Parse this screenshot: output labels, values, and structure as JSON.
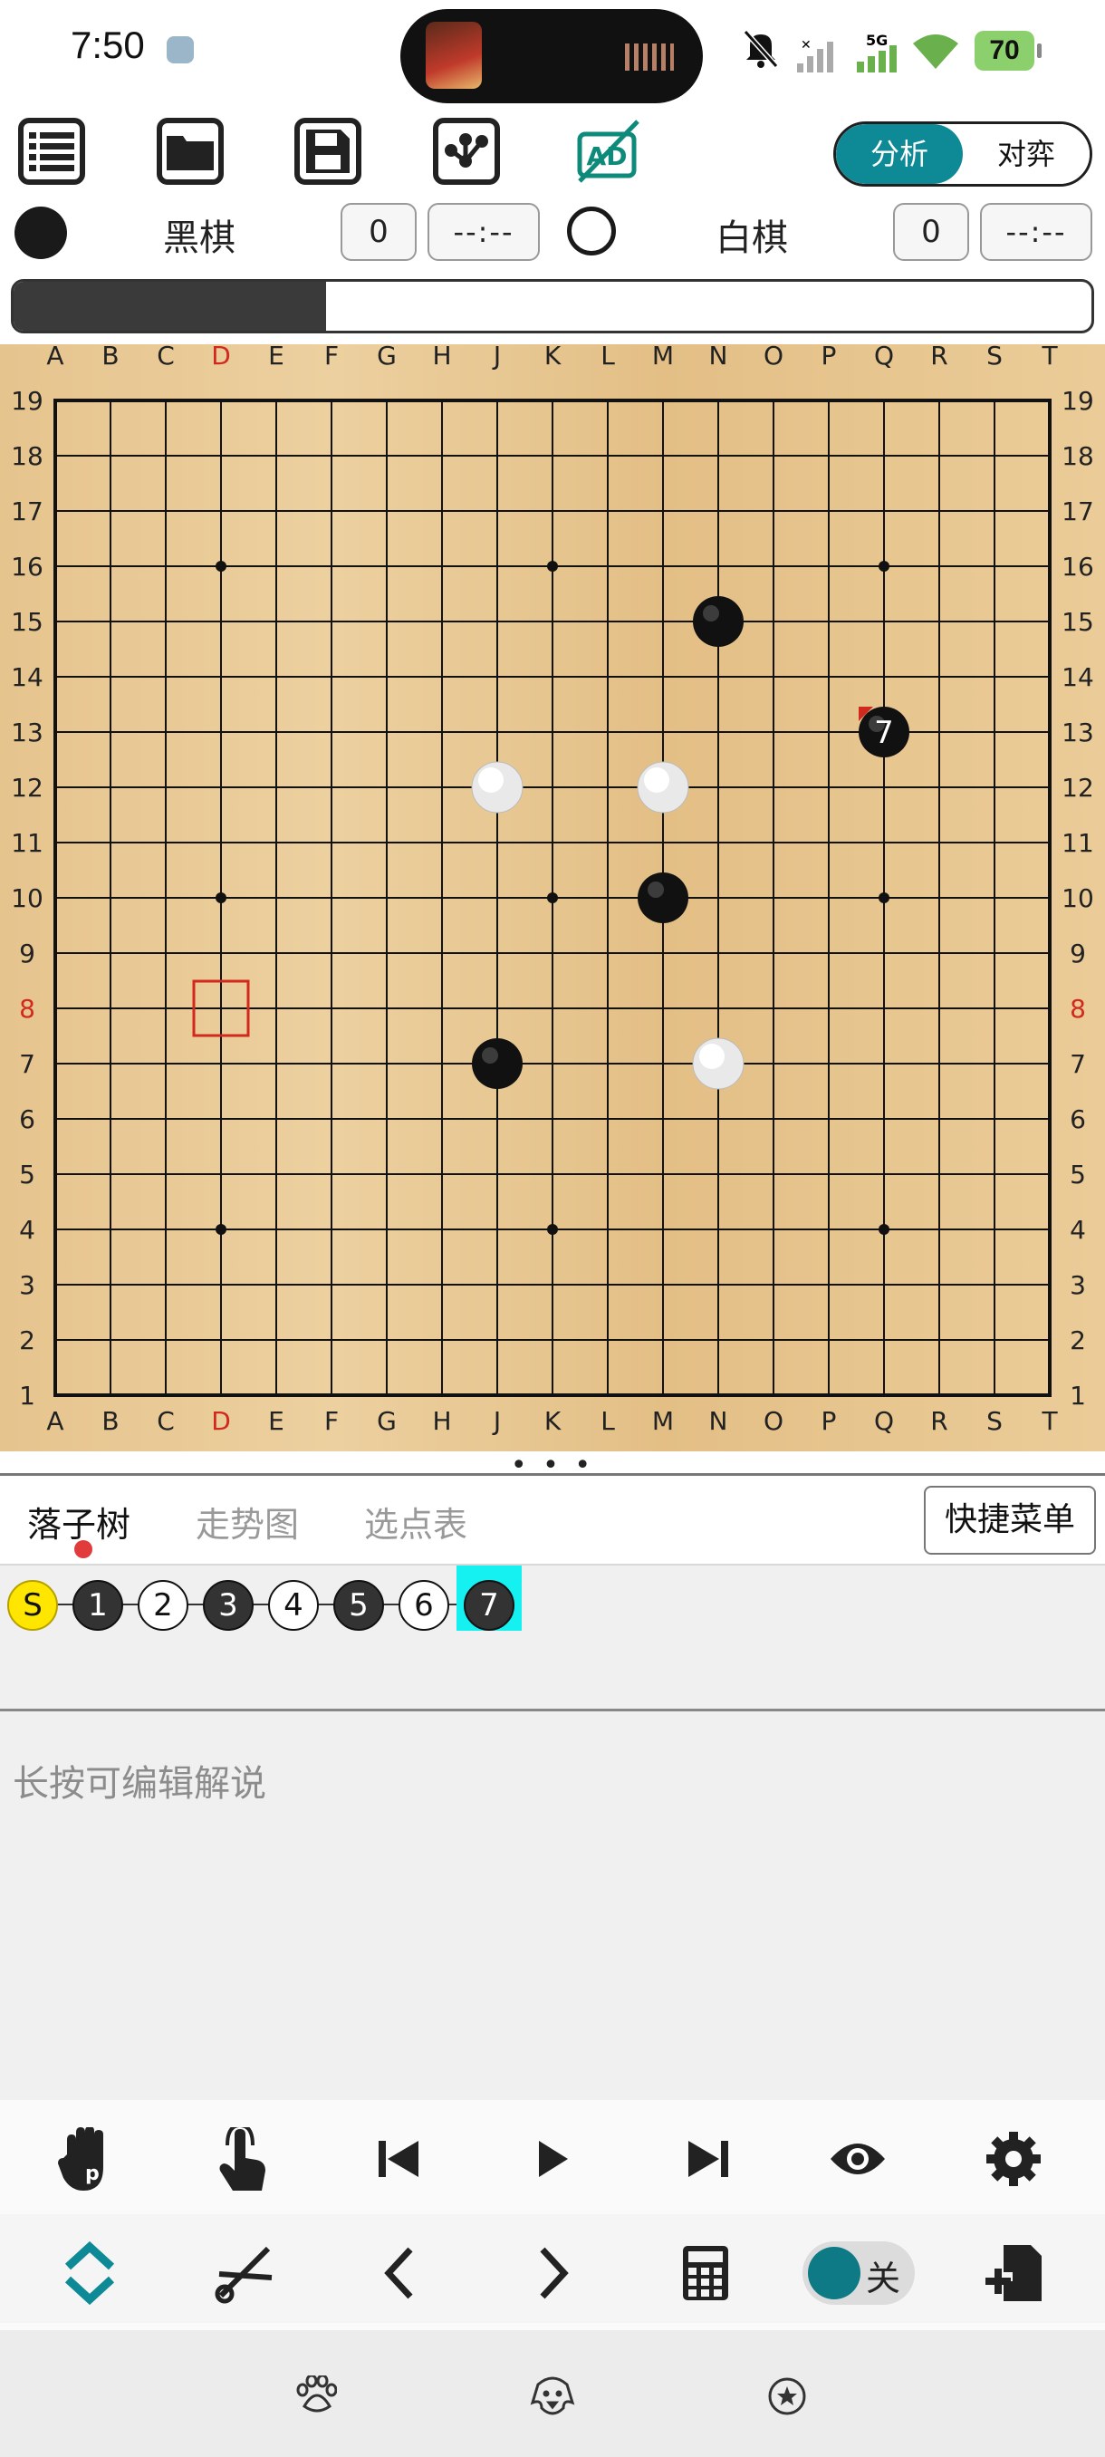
{
  "status_bar": {
    "time": "7:50",
    "network": "5G",
    "battery": "70"
  },
  "toolbar": {
    "items": [
      {
        "name": "list-icon"
      },
      {
        "name": "folder-icon"
      },
      {
        "name": "save-icon"
      },
      {
        "name": "tree-icon"
      },
      {
        "name": "ad-off-icon",
        "label": "AD"
      }
    ],
    "mode_analysis": "分析",
    "mode_play": "对弈"
  },
  "players": {
    "black": {
      "label": "黑棋",
      "captures": "0",
      "time": "--:--"
    },
    "white": {
      "label": "白棋",
      "captures": "0",
      "time": "--:--"
    }
  },
  "winrate": {
    "black_fraction": 0.29
  },
  "board": {
    "size": 19,
    "columns": [
      "A",
      "B",
      "C",
      "D",
      "E",
      "F",
      "G",
      "H",
      "J",
      "K",
      "L",
      "M",
      "N",
      "O",
      "P",
      "Q",
      "R",
      "S",
      "T"
    ],
    "rows": [
      "19",
      "18",
      "17",
      "16",
      "15",
      "14",
      "13",
      "12",
      "11",
      "10",
      "9",
      "8",
      "7",
      "6",
      "5",
      "4",
      "3",
      "2",
      "1"
    ],
    "highlight_column": "D",
    "highlight_row": "8",
    "colors": {
      "grid": "#111111",
      "highlight": "#d0291e",
      "wood": "#e8c892"
    },
    "stones": [
      {
        "point": "N15",
        "color": "black"
      },
      {
        "point": "Q13",
        "color": "black",
        "label": "7",
        "last": true
      },
      {
        "point": "J12",
        "color": "white"
      },
      {
        "point": "M12",
        "color": "white"
      },
      {
        "point": "M10",
        "color": "black"
      },
      {
        "point": "J7",
        "color": "black"
      },
      {
        "point": "N7",
        "color": "white"
      }
    ],
    "cursor_point": "D8"
  },
  "handle_glyph": "• • •",
  "panel_tabs": [
    {
      "label": "落子树",
      "active": true
    },
    {
      "label": "走势图",
      "active": false
    },
    {
      "label": "选点表",
      "active": false
    }
  ],
  "quick_menu": "快捷菜单",
  "move_tree": [
    {
      "label": "S",
      "kind": "s"
    },
    {
      "label": "1",
      "kind": "b"
    },
    {
      "label": "2",
      "kind": "w"
    },
    {
      "label": "3",
      "kind": "b"
    },
    {
      "label": "4",
      "kind": "w"
    },
    {
      "label": "5",
      "kind": "b"
    },
    {
      "label": "6",
      "kind": "w"
    },
    {
      "label": "7",
      "kind": "b",
      "selected": true
    }
  ],
  "comment_placeholder": "长按可编辑解说",
  "controls": {
    "row1": [
      "hand-p-icon",
      "touch-icon",
      "first-move-icon",
      "play-icon",
      "last-move-icon",
      "eye-icon",
      "gear-icon"
    ],
    "row2": [
      "collapse-icon",
      "scissors-icon",
      "prev-icon",
      "next-icon",
      "calculator-icon",
      "toggle",
      "add-file-icon"
    ],
    "toggle_label": "关"
  },
  "nav_bar": [
    "paw-icon",
    "dog-icon",
    "star-icon"
  ]
}
